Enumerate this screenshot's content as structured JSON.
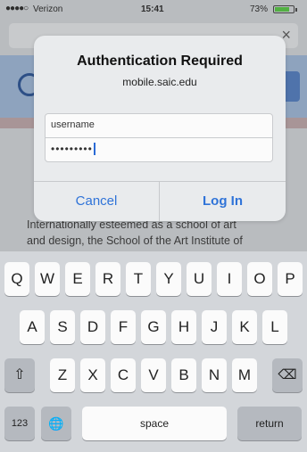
{
  "status_bar": {
    "signal": "●●●●○",
    "carrier": "Verizon",
    "wifi_icon": "wifi-icon",
    "time": "15:41",
    "battery_text": "73%"
  },
  "background_page": {
    "close_glyph": "×",
    "text_lines": [
      "Internationally esteemed as a school of art",
      "and design, the School of the Art Institute of"
    ]
  },
  "alert": {
    "title": "Authentication Required",
    "message": "mobile.saic.edu",
    "username_value": "username",
    "password_value": "•••••••••",
    "cancel_label": "Cancel",
    "login_label": "Log In"
  },
  "keyboard": {
    "row1": [
      "Q",
      "W",
      "E",
      "R",
      "T",
      "Y",
      "U",
      "I",
      "O",
      "P"
    ],
    "row2": [
      "A",
      "S",
      "D",
      "F",
      "G",
      "H",
      "J",
      "K",
      "L"
    ],
    "row3": [
      "Z",
      "X",
      "C",
      "V",
      "B",
      "N",
      "M"
    ],
    "shift_glyph": "⇧",
    "delete_glyph": "⌫",
    "numbers_label": "123",
    "globe_glyph": "🌐",
    "space_label": "space",
    "return_label": "return"
  },
  "colors": {
    "accent_blue": "#2f73d8",
    "battery_green": "#52b043"
  }
}
